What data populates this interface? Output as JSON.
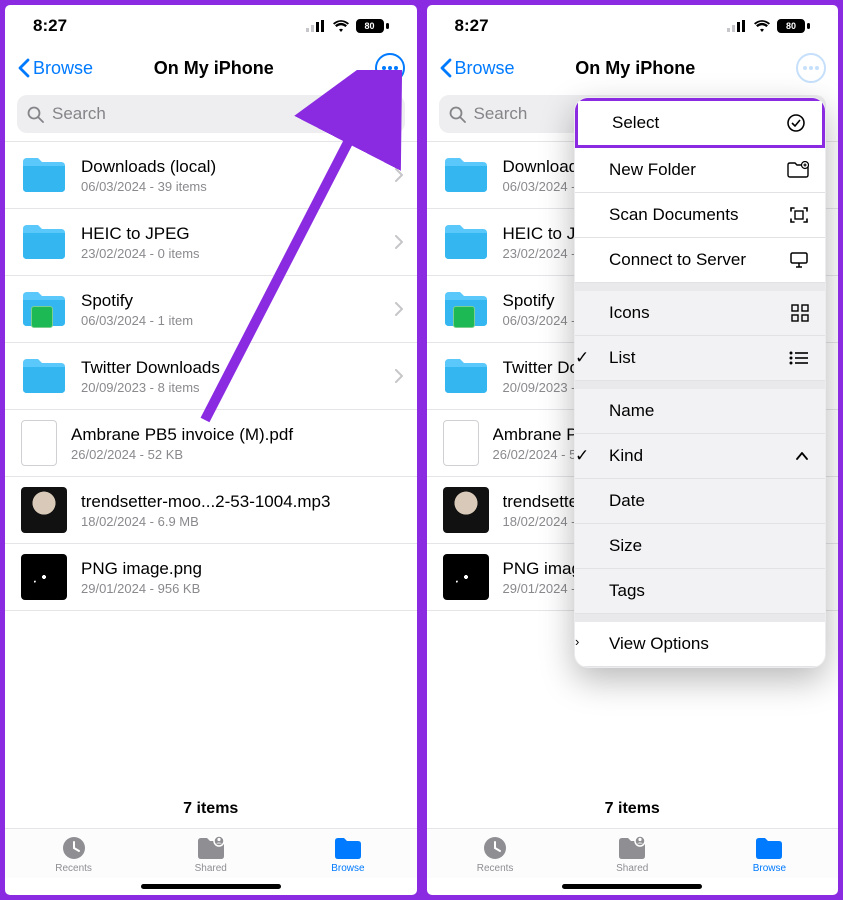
{
  "status": {
    "time": "8:27",
    "battery": "80"
  },
  "nav": {
    "back": "Browse",
    "title": "On My iPhone"
  },
  "search": {
    "placeholder": "Search"
  },
  "items": [
    {
      "name": "Downloads (local)",
      "meta": "06/03/2024 - 39 items",
      "kind": "folder"
    },
    {
      "name": "HEIC to JPEG",
      "meta": "23/02/2024 - 0 items",
      "kind": "folder"
    },
    {
      "name": "Spotify",
      "meta": "06/03/2024 - 1 item",
      "kind": "folder-spotify"
    },
    {
      "name": "Twitter Downloads",
      "meta": "20/09/2023 - 8 items",
      "kind": "folder"
    },
    {
      "name": "Ambrane PB5 invoice (M).pdf",
      "meta": "26/02/2024 - 52 KB",
      "kind": "doc"
    },
    {
      "name": "trendsetter-moo...2-53-1004.mp3",
      "meta": "18/02/2024 - 6.9 MB",
      "kind": "mp3"
    },
    {
      "name": "PNG image.png",
      "meta": "29/01/2024 - 956 KB",
      "kind": "png"
    }
  ],
  "footer": {
    "count": "7 items"
  },
  "tabs": {
    "recents": "Recents",
    "shared": "Shared",
    "browse": "Browse"
  },
  "menu": {
    "select": "Select",
    "new_folder": "New Folder",
    "scan": "Scan Documents",
    "connect": "Connect to Server",
    "icons": "Icons",
    "list": "List",
    "name": "Name",
    "kind": "Kind",
    "date": "Date",
    "size": "Size",
    "tags": "Tags",
    "view_options": "View Options"
  },
  "truncated": {
    "heic": "HEIC to…",
    "spotify": "Spotify",
    "twitter": "Twitter D…",
    "ambrane": "Ambran…",
    "trend": "trendset…",
    "png": "PNG ima…"
  }
}
